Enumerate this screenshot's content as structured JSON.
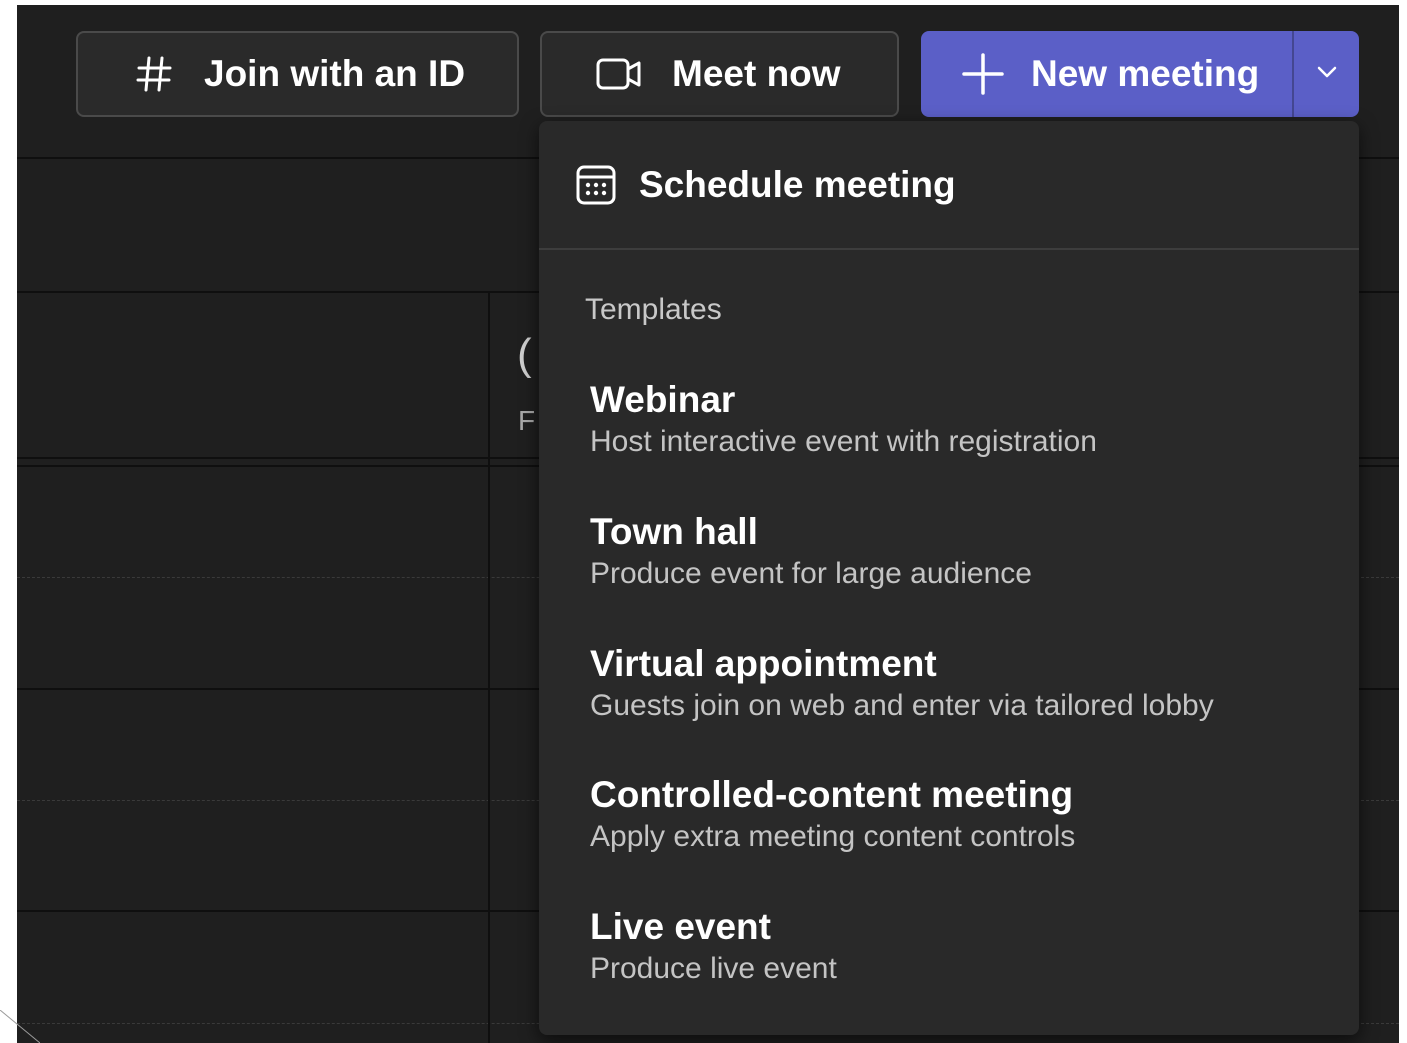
{
  "toolbar": {
    "join_label": "Join with an ID",
    "join_icon": "hash-icon",
    "meet_label": "Meet now",
    "meet_icon": "video-camera-icon",
    "new_label": "New meeting",
    "new_icon": "plus-icon",
    "new_dropdown_icon": "chevron-down-icon"
  },
  "background": {
    "peek_big": "(",
    "peek_small": "F"
  },
  "menu": {
    "schedule_label": "Schedule meeting",
    "schedule_icon": "calendar-icon",
    "section_label": "Templates",
    "templates": [
      {
        "title": "Webinar",
        "description": "Host interactive event with registration"
      },
      {
        "title": "Town hall",
        "description": "Produce event for large audience"
      },
      {
        "title": "Virtual appointment",
        "description": "Guests join on web and enter via tailored lobby"
      },
      {
        "title": "Controlled-content meeting",
        "description": "Apply extra meeting content controls"
      },
      {
        "title": "Live event",
        "description": "Produce live event"
      }
    ]
  },
  "colors": {
    "background": "#1f1f1f",
    "menu_background": "#292929",
    "accent": "#5b5fc7",
    "text_primary": "#ffffff",
    "text_secondary": "#c4c4c4"
  }
}
